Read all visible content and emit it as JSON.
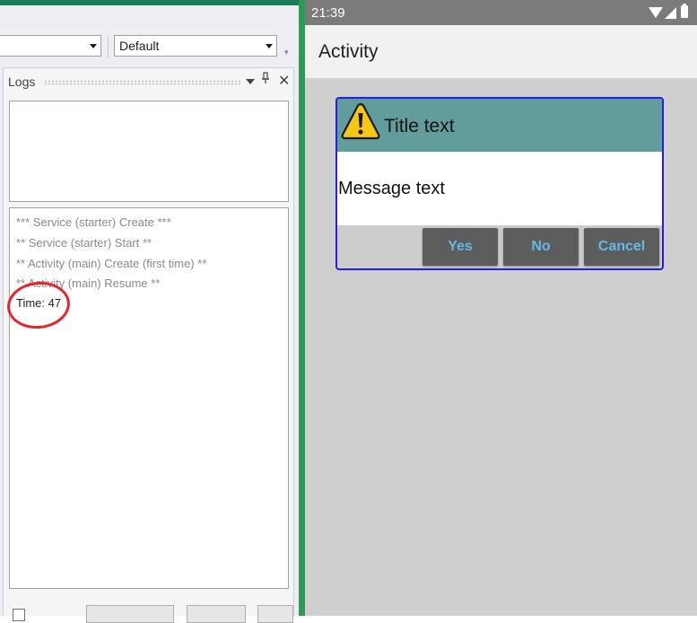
{
  "ide": {
    "toolbar": {
      "combo_left_value": "",
      "combo_right_value": "Default"
    },
    "logs_panel": {
      "title": "Logs",
      "log_lines": [
        "*** Service (starter) Create ***",
        "** Service (starter) Start **",
        "** Activity (main) Create (first time) **",
        "** Activity (main) Resume **",
        "Time: 47"
      ]
    }
  },
  "phone": {
    "status_bar": {
      "time": "21:39"
    },
    "app_bar": {
      "title": "Activity"
    },
    "dialog": {
      "title": "Title text",
      "message": "Message text",
      "buttons": {
        "yes": "Yes",
        "no": "No",
        "cancel": "Cancel"
      }
    }
  },
  "colors": {
    "ide_accent": "#1e7b58",
    "divider": "#2f9a55",
    "dialog_header": "#639c9c",
    "dialog_border": "#2020e0",
    "button_text": "#65b9e6",
    "annotation_circle": "#e3262c"
  },
  "icons": [
    "chevron-down-icon",
    "pin-icon",
    "close-icon",
    "wifi-icon",
    "signal-icon",
    "battery-icon",
    "warning-icon"
  ]
}
